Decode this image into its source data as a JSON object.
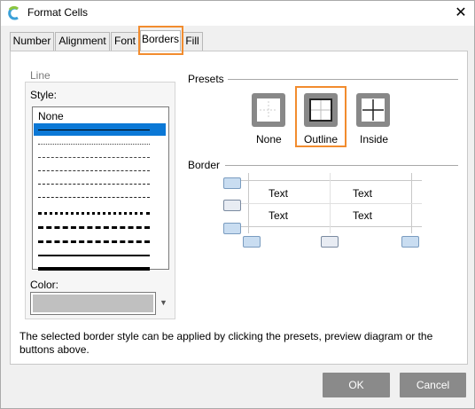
{
  "window": {
    "title": "Format Cells",
    "close_glyph": "✕",
    "app_icon": "spreadsheet-app-icon"
  },
  "tabs": [
    {
      "label": "Number",
      "active": false
    },
    {
      "label": "Alignment",
      "active": false
    },
    {
      "label": "Font",
      "active": false
    },
    {
      "label": "Borders",
      "active": true
    },
    {
      "label": "Fill",
      "active": false
    }
  ],
  "line": {
    "group_label": "Line",
    "style_label": "Style:",
    "style_none_label": "None",
    "selected_index": 1,
    "color_label": "Color:",
    "color_value": "#c0c0c0"
  },
  "presets": {
    "label": "Presets",
    "items": [
      {
        "label": "None"
      },
      {
        "label": "Outline"
      },
      {
        "label": "Inside"
      }
    ],
    "highlighted": "Outline"
  },
  "border": {
    "label": "Border",
    "cells": [
      "Text",
      "Text",
      "Text",
      "Text"
    ]
  },
  "footer_text": "The selected border style can be applied by clicking the presets, preview diagram or the buttons above.",
  "buttons": {
    "ok": "OK",
    "cancel": "Cancel"
  },
  "colors": {
    "highlight": "#f28c2e",
    "selection": "#0b78d6",
    "button_bg": "#8a8a8a"
  }
}
